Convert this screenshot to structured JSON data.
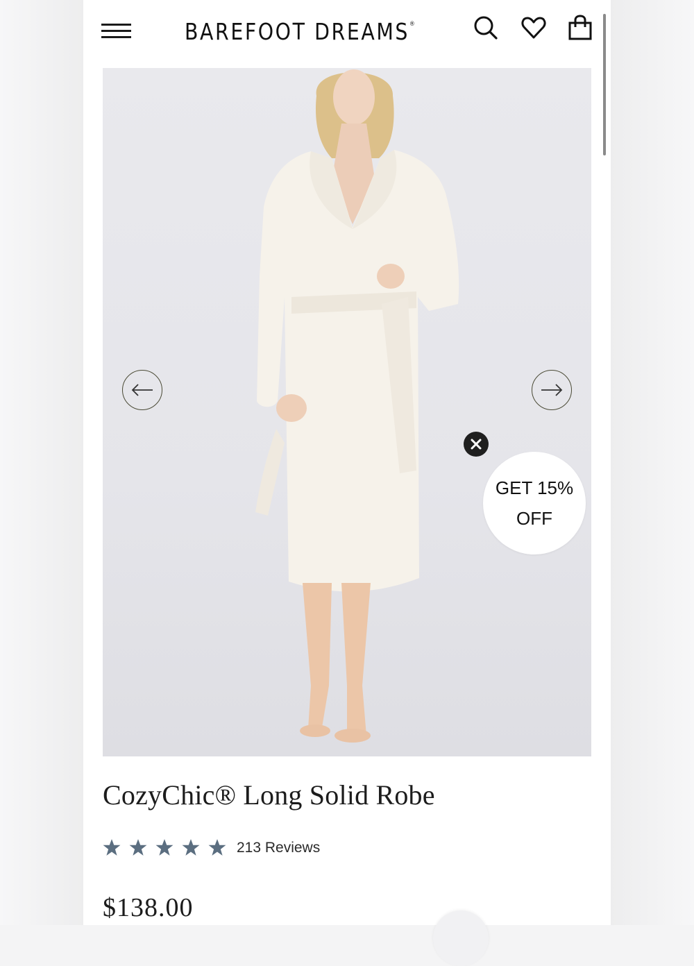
{
  "header": {
    "brand": "BAREFOOT DREAMS",
    "brand_mark": "®",
    "icons": [
      "menu-icon",
      "search-icon",
      "heart-icon",
      "bag-icon"
    ]
  },
  "gallery": {
    "prev_icon": "arrow-left-icon",
    "next_icon": "arrow-right-icon",
    "background": "#e7e7eb",
    "arrow_color": "#4a4a35"
  },
  "promo": {
    "line1": "GET 15%",
    "line2": "OFF",
    "close_icon": "close-icon"
  },
  "product": {
    "title": "CozyChic® Long Solid Robe",
    "rating_stars": 5,
    "reviews": "213 Reviews",
    "price": "$138.00",
    "star_color": "#5b6e80"
  }
}
